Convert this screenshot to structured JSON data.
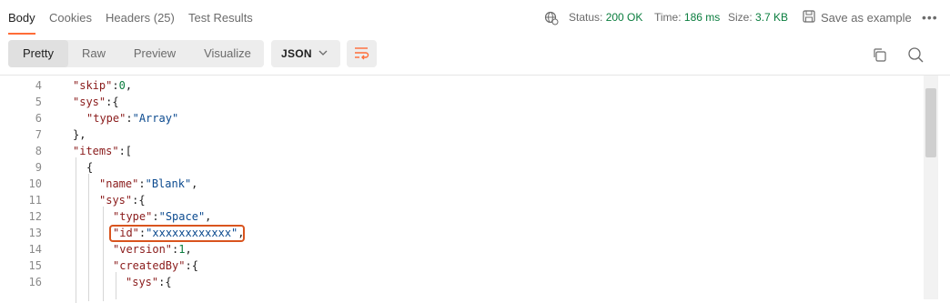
{
  "tabs": [
    {
      "label": "Body",
      "active": true
    },
    {
      "label": "Cookies",
      "active": false
    },
    {
      "label": "Headers (25)",
      "active": false
    },
    {
      "label": "Test Results",
      "active": false
    }
  ],
  "status": {
    "status_label": "Status:",
    "status_value": "200 OK",
    "time_label": "Time:",
    "time_value": "186 ms",
    "size_label": "Size:",
    "size_value": "3.7 KB"
  },
  "save_example_label": "Save as example",
  "more_label": "•••",
  "view_modes": [
    {
      "label": "Pretty",
      "active": true
    },
    {
      "label": "Raw",
      "active": false
    },
    {
      "label": "Preview",
      "active": false
    },
    {
      "label": "Visualize",
      "active": false
    }
  ],
  "format": {
    "selected": "JSON"
  },
  "colors": {
    "accent": "#ff6c37",
    "status_ok": "#0a7d3e",
    "key": "#8a1b1b",
    "string": "#0b4a8f",
    "highlight_border": "#d9541e"
  },
  "icons": [
    "globe-icon",
    "save-icon",
    "more-icon",
    "chevron-down-icon",
    "wrap-lines-icon",
    "copy-icon",
    "search-icon"
  ],
  "code_lines": [
    {
      "num": "4",
      "text": "\"skip\":0,"
    },
    {
      "num": "5",
      "text": "\"sys\":{"
    },
    {
      "num": "6",
      "text": "\"type\":\"Array\""
    },
    {
      "num": "7",
      "text": "},"
    },
    {
      "num": "8",
      "text": "\"items\":["
    },
    {
      "num": "9",
      "text": "{"
    },
    {
      "num": "10",
      "text": "\"name\":\"Blank\","
    },
    {
      "num": "11",
      "text": "\"sys\":{"
    },
    {
      "num": "12",
      "text": "\"type\":\"Space\","
    },
    {
      "num": "13",
      "text": "\"id\":\"xxxxxxxxxxxx\","
    },
    {
      "num": "14",
      "text": "\"version\":1,"
    },
    {
      "num": "15",
      "text": "\"createdBy\":{"
    },
    {
      "num": "16",
      "text": "\"sys\":{"
    }
  ]
}
